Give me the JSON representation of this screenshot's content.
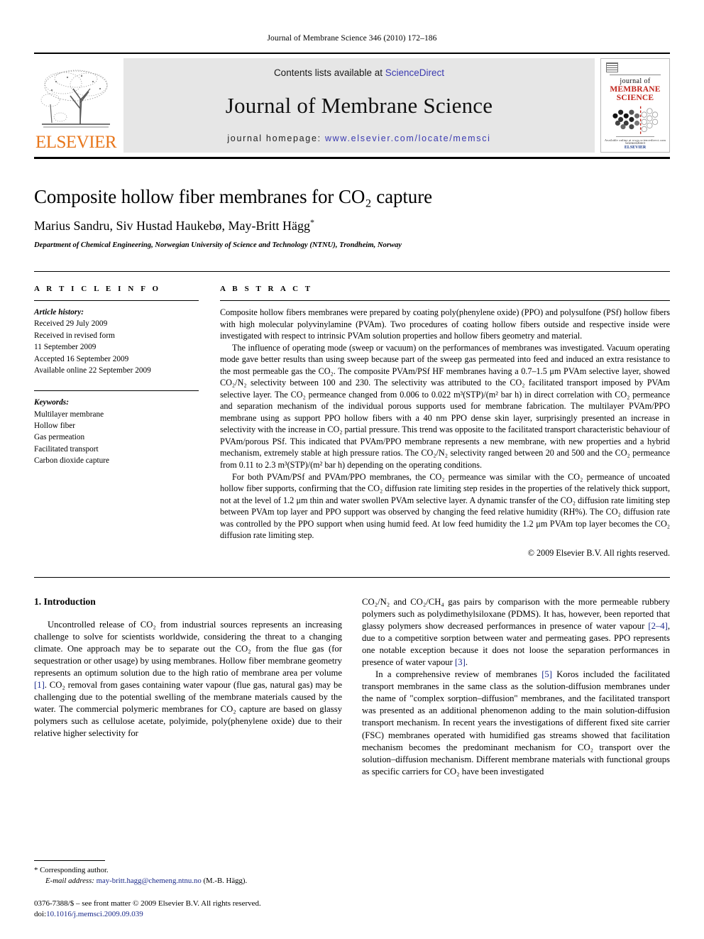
{
  "running_head": "Journal of Membrane Science 346 (2010) 172–186",
  "masthead": {
    "elsevier_wordmark": "ELSEVIER",
    "contents_prefix": "Contents lists available at ",
    "sciencedirect": "ScienceDirect",
    "journal_title": "Journal of Membrane Science",
    "homepage_prefix": "journal homepage: ",
    "homepage_url": "www.elsevier.com/locate/memsci",
    "cover": {
      "line1": "journal of",
      "line2": "MEMBRANE",
      "line3": "SCIENCE",
      "footer1": "Available online at www.sciencedirect.com",
      "footer2": "ScienceDirect",
      "footer3": "ELSEVIER"
    }
  },
  "article": {
    "title": "Composite hollow fiber membranes for CO₂ capture",
    "authors": "Marius Sandru, Siv Hustad Haukebø, May-Britt Hägg",
    "corresponding_marker": "*",
    "affiliation": "Department of Chemical Engineering, Norwegian University of Science and Technology (NTNU), Trondheim, Norway"
  },
  "article_info": {
    "label": "A R T I C L E   I N F O",
    "history_label": "Article history:",
    "history": [
      "Received 29 July 2009",
      "Received in revised form",
      "11 September 2009",
      "Accepted 16 September 2009",
      "Available online 22 September 2009"
    ],
    "keywords_label": "Keywords:",
    "keywords": [
      "Multilayer membrane",
      "Hollow fiber",
      "Gas permeation",
      "Facilitated transport",
      "Carbon dioxide capture"
    ]
  },
  "abstract": {
    "label": "A B S T R A C T",
    "paragraphs": [
      "Composite hollow fibers membranes were prepared by coating poly(phenylene oxide) (PPO) and polysulfone (PSf) hollow fibers with high molecular polyvinylamine (PVAm). Two procedures of coating hollow fibers outside and respective inside were investigated with respect to intrinsic PVAm solution properties and hollow fibers geometry and material.",
      "The influence of operating mode (sweep or vacuum) on the performances of membranes was investigated. Vacuum operating mode gave better results than using sweep because part of the sweep gas permeated into feed and induced an extra resistance to the most permeable gas the CO₂. The composite PVAm/PSf HF membranes having a 0.7–1.5 μm PVAm selective layer, showed CO₂/N₂ selectivity between 100 and 230. The selectivity was attributed to the CO₂ facilitated transport imposed by PVAm selective layer. The CO₂ permeance changed from 0.006 to 0.022 m³(STP)/(m² bar h) in direct correlation with CO₂ permeance and separation mechanism of the individual porous supports used for membrane fabrication. The multilayer PVAm/PPO membrane using as support PPO hollow fibers with a 40 nm PPO dense skin layer, surprisingly presented an increase in selectivity with the increase in CO₂ partial pressure. This trend was opposite to the facilitated transport characteristic behaviour of PVAm/porous PSf. This indicated that PVAm/PPO membrane represents a new membrane, with new properties and a hybrid mechanism, extremely stable at high pressure ratios. The CO₂/N₂ selectivity ranged between 20 and 500 and the CO₂ permeance from 0.11 to 2.3 m³(STP)/(m² bar h) depending on the operating conditions.",
      "For both PVAm/PSf and PVAm/PPO membranes, the CO₂ permeance was similar with the CO₂ permeance of uncoated hollow fiber supports, confirming that the CO₂ diffusion rate limiting step resides in the properties of the relatively thick support, not at the level of 1.2 μm thin and water swollen PVAm selective layer. A dynamic transfer of the CO₂ diffusion rate limiting step between PVAm top layer and PPO support was observed by changing the feed relative humidity (RH%). The CO₂ diffusion rate was controlled by the PPO support when using humid feed. At low feed humidity the 1.2 μm PVAm top layer becomes the CO₂ diffusion rate limiting step."
    ],
    "copyright": "© 2009 Elsevier B.V. All rights reserved."
  },
  "introduction": {
    "heading": "1. Introduction",
    "left_paragraph": "Uncontrolled release of CO₂ from industrial sources represents an increasing challenge to solve for scientists worldwide, considering the threat to a changing climate. One approach may be to separate out the CO₂ from the flue gas (for sequestration or other usage) by using membranes. Hollow fiber membrane geometry represents an optimum solution due to the high ratio of membrane area per volume [1]. CO₂ removal from gases containing water vapour (flue gas, natural gas) may be challenging due to the potential swelling of the membrane materials caused by the water. The commercial polymeric membranes for CO₂ capture are based on glassy polymers such as cellulose acetate, polyimide, poly(phenylene oxide) due to their relative higher selectivity for",
    "right_paragraph_1": "CO₂/N₂ and CO₂/CH₄ gas pairs by comparison with the more permeable rubbery polymers such as polydimethylsiloxane (PDMS). It has, however, been reported that glassy polymers show decreased performances in presence of water vapour [2–4], due to a competitive sorption between water and permeating gases. PPO represents one notable exception because it does not loose the separation performances in presence of water vapour [3].",
    "right_paragraph_2": "In a comprehensive review of membranes [5] Koros included the facilitated transport membranes in the same class as the solution-diffusion membranes under the name of \"complex sorption–diffusion\" membranes, and the facilitated transport was presented as an additional phenomenon adding to the main solution-diffusion transport mechanism. In recent years the investigations of different fixed site carrier (FSC) membranes operated with humidified gas streams showed that facilitation mechanism becomes the predominant mechanism for CO₂ transport over the solution–diffusion mechanism. Different membrane materials with functional groups as specific carriers for CO₂ have been investigated"
  },
  "footnotes": {
    "corresponding_marker": "*",
    "corresponding_label": "Corresponding author.",
    "email_label": "E-mail address:",
    "email": "may-britt.hagg@chemeng.ntnu.no",
    "email_suffix": "(M.-B. Hägg).",
    "imprint_line": "0376-7388/$ – see front matter © 2009 Elsevier B.V. All rights reserved.",
    "doi_label": "doi:",
    "doi_value": "10.1016/j.memsci.2009.09.039"
  },
  "colors": {
    "link": "#3a3ab0",
    "citation": "#1b2a8a",
    "elsevier_orange": "#E8761B",
    "cover_red": "#C0241B",
    "banner_bg": "#e6e6e6"
  }
}
